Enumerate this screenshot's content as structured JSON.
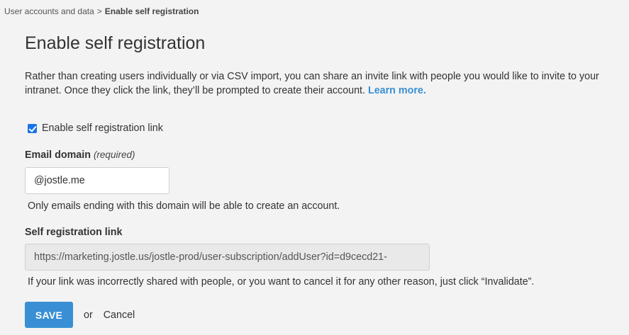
{
  "breadcrumb": {
    "parent": "User accounts and data",
    "separator": ">",
    "current": "Enable self registration"
  },
  "page": {
    "title": "Enable self registration",
    "description": "Rather than creating users individually or via CSV import, you can share an invite link with people you would like to invite to your intranet. Once they click the link, they’ll be prompted to create their account.",
    "learn_more": "Learn more."
  },
  "self_registration": {
    "checkbox_label": "Enable self registration link",
    "checked": true
  },
  "email_domain": {
    "label": "Email domain",
    "required_note": "(required)",
    "value": "@jostle.me",
    "help": "Only emails ending with this domain will be able to create an account."
  },
  "registration_link": {
    "label": "Self registration link",
    "value": "https://marketing.jostle.us/jostle-prod/user-subscription/addUser?id=d9cecd21-",
    "help": "If your link was incorrectly shared with people, or you want to cancel it for any other reason, just click “Invalidate”."
  },
  "actions": {
    "save_label": "SAVE",
    "or_label": "or",
    "cancel_label": "Cancel"
  },
  "colors": {
    "accent": "#3a8fd4",
    "checkbox": "#1a73e8",
    "background": "#f3f3f3"
  }
}
